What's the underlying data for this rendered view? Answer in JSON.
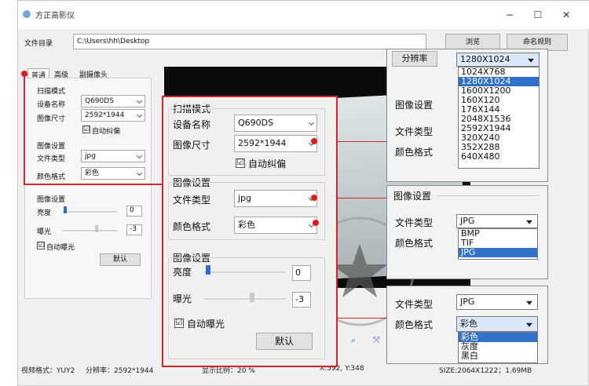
{
  "window": {
    "title": "方正高影仪",
    "minimize": "−",
    "maximize": "☐",
    "close": "✕"
  },
  "file_dir": {
    "label": "文件目录",
    "value": "C:\\Users\\hh\\Desktop",
    "browse": "浏览",
    "rename": "命名规则"
  },
  "tabs": [
    "普通",
    "高级",
    "副摄像头"
  ],
  "scan_mode": {
    "title": "扫描模式",
    "device_label": "设备名称",
    "device_value": "Q690DS",
    "size_label": "图像尺寸",
    "size_value": "2592*1944",
    "autocorrect_label": "自动纠偏",
    "autocorrect_checked": "☑"
  },
  "image_settings": {
    "title": "图像设置",
    "filetype_label": "文件类型",
    "filetype_value": "jpg",
    "color_label": "颜色格式",
    "color_value": "彩色"
  },
  "image_adjust": {
    "title": "图像设置",
    "brightness_label": "亮度",
    "brightness_value": "0",
    "exposure_label": "曝光",
    "exposure_value": "-3",
    "autoexposure_label": "自动曝光",
    "default_button": "默认"
  },
  "statusbar": {
    "video_format": "视频格式：YUY2",
    "resolution": "分辨率：2592*1944",
    "display_ratio": "显示比例：20 %",
    "coords": "X:592, Y:348",
    "size": "SIZE:2064X1222；1.69MB"
  },
  "resolution_popup": {
    "label": "分辨率",
    "selected": "1280X1024",
    "options": [
      "1024X768",
      "1280X1024",
      "1600X1200",
      "160X120",
      "176X144",
      "2048X1536",
      "2592X1944",
      "320X240",
      "352X288",
      "640X480"
    ],
    "behind_title": "图像设置",
    "behind_filetype": "文件类型",
    "behind_color": "颜色格式"
  },
  "filetype_popup": {
    "title": "图像设置",
    "filetype_label": "文件类型",
    "selected": "JPG",
    "options": [
      "BMP",
      "TIF",
      "JPG"
    ],
    "color_label": "颜色格式"
  },
  "color_popup": {
    "filetype_label": "文件类型",
    "filetype_value": "JPG",
    "color_label": "颜色格式",
    "selected": "彩色",
    "options": [
      "彩色",
      "灰度",
      "黑白"
    ]
  },
  "colors": {
    "accent_red": "#d02828",
    "selection_blue": "#3071c9",
    "slider_blue": "#2b6fd0"
  }
}
